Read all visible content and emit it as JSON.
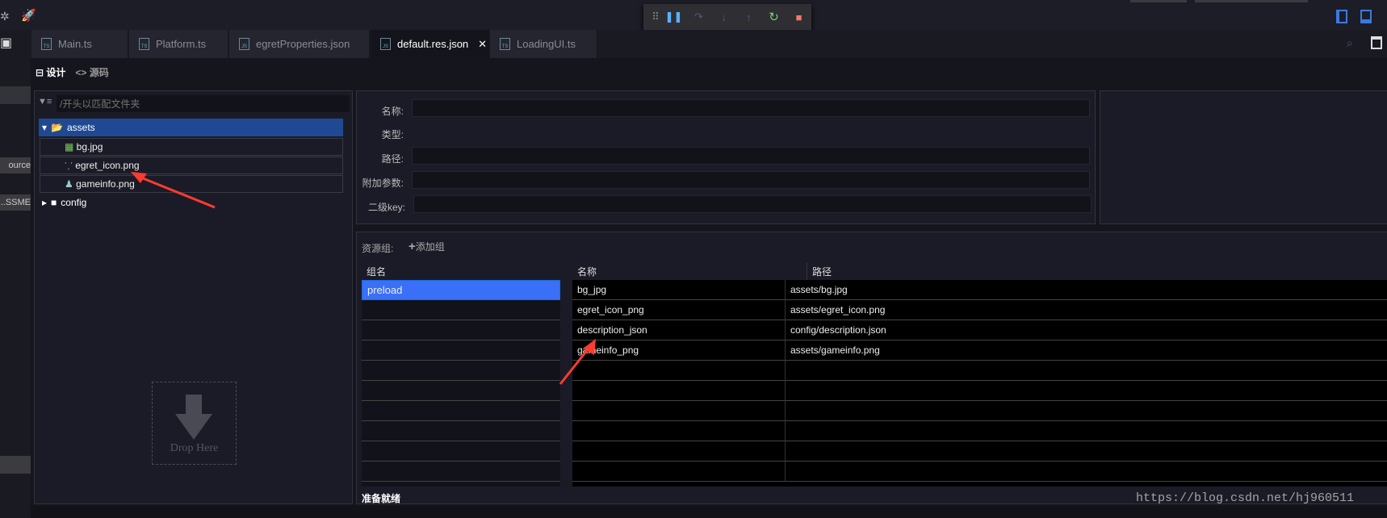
{
  "debug_toolbar": {
    "buttons": [
      "pause",
      "step-over",
      "step-into",
      "step-out",
      "restart",
      "stop"
    ]
  },
  "tabs": [
    {
      "label": "Main.ts",
      "type": "TS"
    },
    {
      "label": "Platform.ts",
      "type": "TS"
    },
    {
      "label": "egretProperties.json",
      "type": "JSON"
    },
    {
      "label": "default.res.json",
      "type": "JSON",
      "active": true
    },
    {
      "label": "LoadingUI.ts",
      "type": "TS"
    }
  ],
  "sidebar": {
    "items": [
      "ource",
      "SSME..."
    ]
  },
  "view_modes": {
    "design": "设计",
    "source": "<> 源码"
  },
  "file_tree": {
    "filter_placeholder": "/开头以匹配文件夹",
    "folders": [
      {
        "label": "assets",
        "expanded": true,
        "files": [
          "bg.jpg",
          "egret_icon.png",
          "gameinfo.png"
        ]
      },
      {
        "label": "config",
        "expanded": false
      }
    ],
    "drop_label": "Drop Here"
  },
  "properties": {
    "name": "名称:",
    "type": "类型:",
    "path": "路径:",
    "extra": "附加参数:",
    "subkey": "二级key:"
  },
  "groups": {
    "label": "资源组:",
    "add_label": "添加组",
    "group_header": "组名",
    "name_header": "名称",
    "path_header": "路径",
    "group_rows": [
      "preload"
    ],
    "resource_rows": [
      {
        "name": "bg_jpg",
        "path": "assets/bg.jpg"
      },
      {
        "name": "egret_icon_png",
        "path": "assets/egret_icon.png"
      },
      {
        "name": "description_json",
        "path": "config/description.json"
      },
      {
        "name": "gameinfo_png",
        "path": "assets/gameinfo.png"
      }
    ]
  },
  "status": "准备就绪",
  "watermark": "https://blog.csdn.net/hj960511",
  "colors": {
    "selection": "#3a6ff7",
    "tree_selection": "#1f4a93",
    "annotation_arrow": "#ff3b30"
  }
}
